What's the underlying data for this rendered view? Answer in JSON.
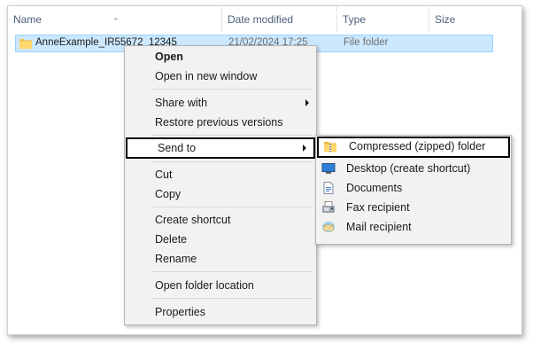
{
  "columns": {
    "name": "Name",
    "date_modified": "Date modified",
    "type": "Type",
    "size": "Size"
  },
  "file": {
    "name": "AnneExample_IR55672_12345",
    "date_modified": "21/02/2024 17:25",
    "type": "File folder",
    "icon": "folder-icon"
  },
  "context_menu": {
    "items": [
      {
        "label": "Open",
        "bold": true
      },
      {
        "label": "Open in new window"
      },
      {
        "label": "Share with",
        "submenu": true
      },
      {
        "label": "Restore previous versions"
      },
      {
        "label": "Send to",
        "submenu": true,
        "highlighted": true
      },
      {
        "label": "Cut"
      },
      {
        "label": "Copy"
      },
      {
        "label": "Create shortcut"
      },
      {
        "label": "Delete"
      },
      {
        "label": "Rename"
      },
      {
        "label": "Open folder location"
      },
      {
        "label": "Properties"
      }
    ]
  },
  "send_to_menu": {
    "items": [
      {
        "label": "Compressed (zipped) folder",
        "icon": "zip-folder-icon",
        "highlighted": true
      },
      {
        "label": "Desktop (create shortcut)",
        "icon": "desktop-icon"
      },
      {
        "label": "Documents",
        "icon": "documents-icon"
      },
      {
        "label": "Fax recipient",
        "icon": "fax-icon"
      },
      {
        "label": "Mail recipient",
        "icon": "mail-icon"
      }
    ]
  },
  "colors": {
    "selection_bg": "#cce8ff",
    "selection_border": "#99d1ff",
    "menu_bg": "#f2f2f2",
    "highlight_border": "#000000",
    "header_text": "#4c607a"
  }
}
